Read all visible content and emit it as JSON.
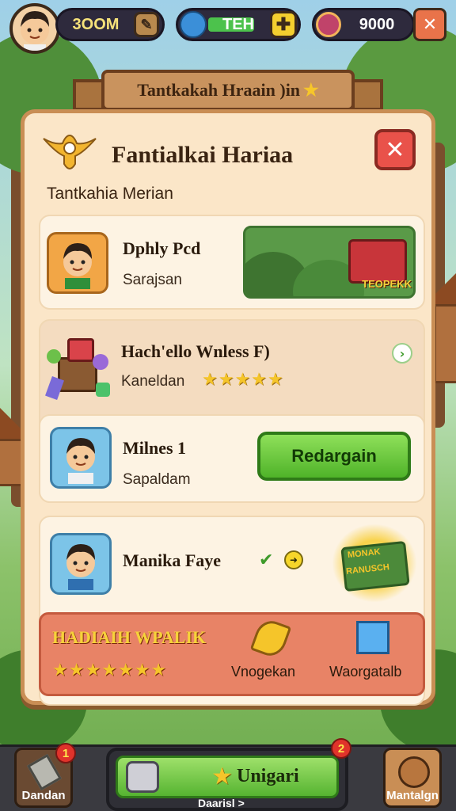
{
  "topbar": {
    "gold": "3OOM",
    "energy": "TEH",
    "gems": "9000"
  },
  "banner": {
    "title": "Tantkakah Hraain )in"
  },
  "panel": {
    "title": "Fantialkai Hariaa",
    "subtitle": "Tantkahia Merian"
  },
  "cards": [
    {
      "title": "Dphly Pcd",
      "sub": "Sarajsan",
      "promo_label": "TEOPEKK"
    },
    {
      "title": "Hach'ello Wnless F)",
      "sub": "Kaneldan",
      "stars": "★★★★★"
    },
    {
      "title": "Milnes 1",
      "sub": "Sapaldam",
      "button": "Redargain"
    },
    {
      "title": "Manika Faye",
      "chest_text": "MONAK",
      "chest_text2": "RANUSCH"
    }
  ],
  "reward": {
    "title": "HADIAIH WPALIK",
    "stars": "★★★★★★★",
    "item1": "Vnogekan",
    "item2": "Waorgatalb"
  },
  "bottom": {
    "left_label": "Dandan",
    "left_badge": "1",
    "center_label": "Unigari",
    "center_sub": "Daarisl >",
    "center_badge": "2",
    "right_label": "Mantalgn"
  },
  "colors": {
    "panel": "#fbe6c8",
    "accent_green": "#56b431",
    "close_red": "#e9524a",
    "reward_bar": "#e88366"
  }
}
